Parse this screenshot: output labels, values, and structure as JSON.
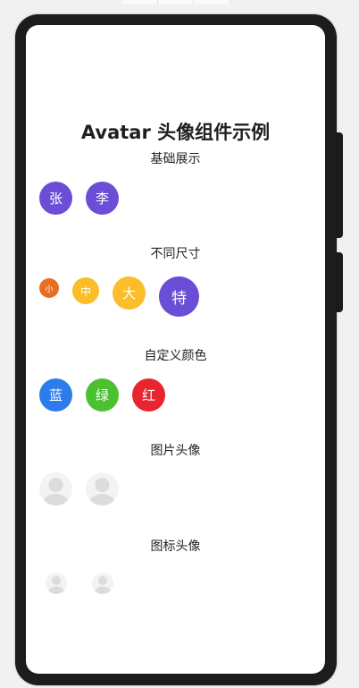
{
  "title": "Avatar 头像组件示例",
  "sections": [
    {
      "label": "基础展示",
      "avatars": [
        {
          "text": "张",
          "color": "#6a4ed6"
        },
        {
          "text": "李",
          "color": "#6a4ed6"
        }
      ]
    },
    {
      "label": "不同尺寸",
      "avatars": [
        {
          "text": "小",
          "color": "#e86f22"
        },
        {
          "text": "中",
          "color": "#fbbd2a"
        },
        {
          "text": "大",
          "color": "#fbbd2a"
        },
        {
          "text": "特",
          "color": "#6a4ed6"
        }
      ]
    },
    {
      "label": "自定义颜色",
      "avatars": [
        {
          "text": "蓝",
          "color": "#2d7cec"
        },
        {
          "text": "绿",
          "color": "#4bc130"
        },
        {
          "text": "红",
          "color": "#e8242f"
        }
      ]
    },
    {
      "label": "图片头像",
      "avatars": [
        {
          "icon": "user-placeholder-icon"
        },
        {
          "icon": "user-placeholder-icon"
        }
      ]
    },
    {
      "label": "图标头像",
      "avatars": [
        {
          "icon": "user-icon"
        },
        {
          "icon": "user-icon"
        }
      ]
    }
  ]
}
